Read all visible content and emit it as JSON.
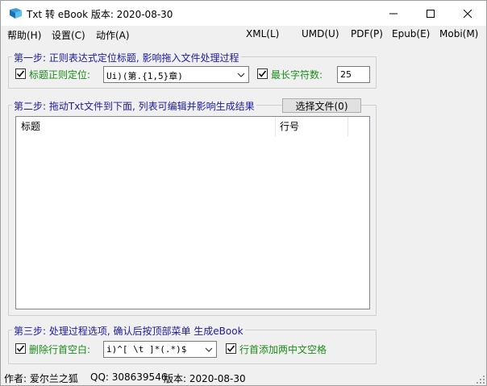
{
  "window": {
    "title": "Txt 转 eBook 版本: 2020-08-30",
    "app_icon": "book-icon",
    "controls": [
      "minimize-icon",
      "maximize-icon",
      "close-icon"
    ]
  },
  "menu": {
    "help": "帮助(H)",
    "settings": "设置(C)",
    "actions": "动作(A)",
    "xml": "XML(L)",
    "umd": "UMD(U)",
    "pdf": "PDF(P)",
    "epub": "Epub(E)",
    "mobi": "Mobi(M)"
  },
  "step1": {
    "title": "第一步: 正则表达式定位标题, 影响拖入文件处理过程",
    "regex_label": "标题正则定位:",
    "regex_checked": true,
    "regex_value": "Ui)(第.{1,5}章)",
    "maxlen_label": "最长字符数:",
    "maxlen_checked": true,
    "maxlen_value": "25"
  },
  "step2": {
    "title": "第二步: 拖动Txt文件到下面, 列表可编辑并影响生成结果",
    "select_button": "选择文件(0)",
    "columns": [
      "标题",
      "行号"
    ],
    "rows": []
  },
  "step3": {
    "title": "第三步: 处理过程选项, 确认后按顶部菜单 生成eBook",
    "trim_label": "删除行首空白:",
    "trim_checked": true,
    "trim_value": "i)^[ \\t  ]*(.*)$",
    "indent_label": "行首添加两中文空格",
    "indent_checked": true
  },
  "status": {
    "author": "作者: 爱尔兰之狐",
    "qq": "QQ: 308639546",
    "version": "版本: 2020-08-30"
  },
  "colors": {
    "group_title": "#1c1c9c",
    "check_label": "#1c8c1c",
    "background": "#f0f0f0"
  }
}
